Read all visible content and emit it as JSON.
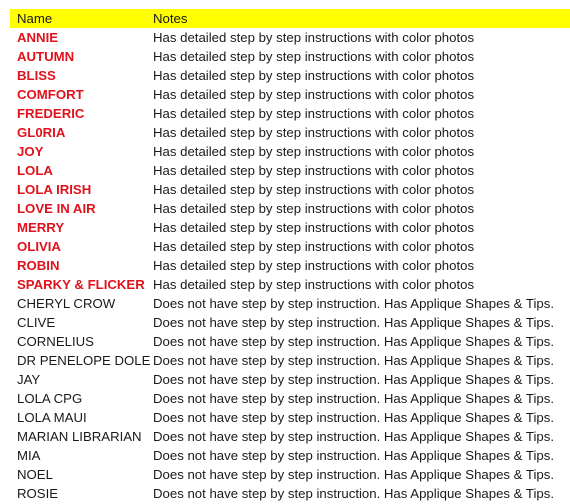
{
  "header": {
    "name": "Name",
    "notes": "Notes"
  },
  "colors": {
    "header_bg": "#ffff00",
    "highlight_name": "#e0121c",
    "text": "#1a1a1a"
  },
  "rows": [
    {
      "name": "ANNIE",
      "notes": "Has detailed step by step instructions with color photos",
      "highlight": true
    },
    {
      "name": "AUTUMN",
      "notes": "Has detailed step by step instructions with color photos",
      "highlight": true
    },
    {
      "name": "BLISS",
      "notes": "Has detailed step by step instructions with color photos",
      "highlight": true
    },
    {
      "name": "COMFORT",
      "notes": "Has detailed step by step instructions with color photos",
      "highlight": true
    },
    {
      "name": "FREDERIC",
      "notes": "Has detailed step by step instructions with color photos",
      "highlight": true
    },
    {
      "name": "GL0RIA",
      "notes": "Has detailed step by step instructions with color photos",
      "highlight": true
    },
    {
      "name": "JOY",
      "notes": "Has detailed step by step instructions with color photos",
      "highlight": true
    },
    {
      "name": "LOLA",
      "notes": "Has detailed step by step instructions with color photos",
      "highlight": true
    },
    {
      "name": "LOLA IRISH",
      "notes": "Has detailed step by step instructions with color photos",
      "highlight": true
    },
    {
      "name": "LOVE IN AIR",
      "notes": "Has detailed step by step instructions with color photos",
      "highlight": true
    },
    {
      "name": "MERRY",
      "notes": "Has detailed step by step instructions with color photos",
      "highlight": true
    },
    {
      "name": "OLIVIA",
      "notes": "Has detailed step by step instructions with color photos",
      "highlight": true
    },
    {
      "name": "ROBIN",
      "notes": "Has detailed step by step instructions with color photos",
      "highlight": true
    },
    {
      "name": "SPARKY & FLICKER",
      "notes": "Has detailed step by step instructions with color photos",
      "highlight": true
    },
    {
      "name": "CHERYL CROW",
      "notes": "Does not have step by step instruction. Has Applique Shapes & Tips.",
      "highlight": false
    },
    {
      "name": "CLIVE",
      "notes": "Does not have step by step instruction. Has Applique Shapes & Tips.",
      "highlight": false
    },
    {
      "name": "CORNELIUS",
      "notes": "Does not have step by step instruction. Has Applique Shapes & Tips.",
      "highlight": false
    },
    {
      "name": "DR PENELOPE DOLE",
      "notes": "Does not have step by step instruction. Has Applique Shapes & Tips.",
      "highlight": false
    },
    {
      "name": "JAY",
      "notes": "Does not have step by step instruction. Has Applique Shapes & Tips.",
      "highlight": false
    },
    {
      "name": "LOLA CPG",
      "notes": "Does not have step by step instruction. Has Applique Shapes & Tips.",
      "highlight": false
    },
    {
      "name": "LOLA MAUI",
      "notes": "Does not have step by step instruction. Has Applique Shapes & Tips.",
      "highlight": false
    },
    {
      "name": "MARIAN LIBRARIAN",
      "notes": "Does not have step by step instruction. Has Applique Shapes & Tips.",
      "highlight": false
    },
    {
      "name": "MIA",
      "notes": "Does not have step by step instruction. Has Applique Shapes & Tips.",
      "highlight": false
    },
    {
      "name": "NOEL",
      "notes": "Does not have step by step instruction. Has Applique Shapes & Tips.",
      "highlight": false
    },
    {
      "name": "ROSIE",
      "notes": "Does not have step by step instruction. Has Applique Shapes & Tips.",
      "highlight": false
    }
  ]
}
